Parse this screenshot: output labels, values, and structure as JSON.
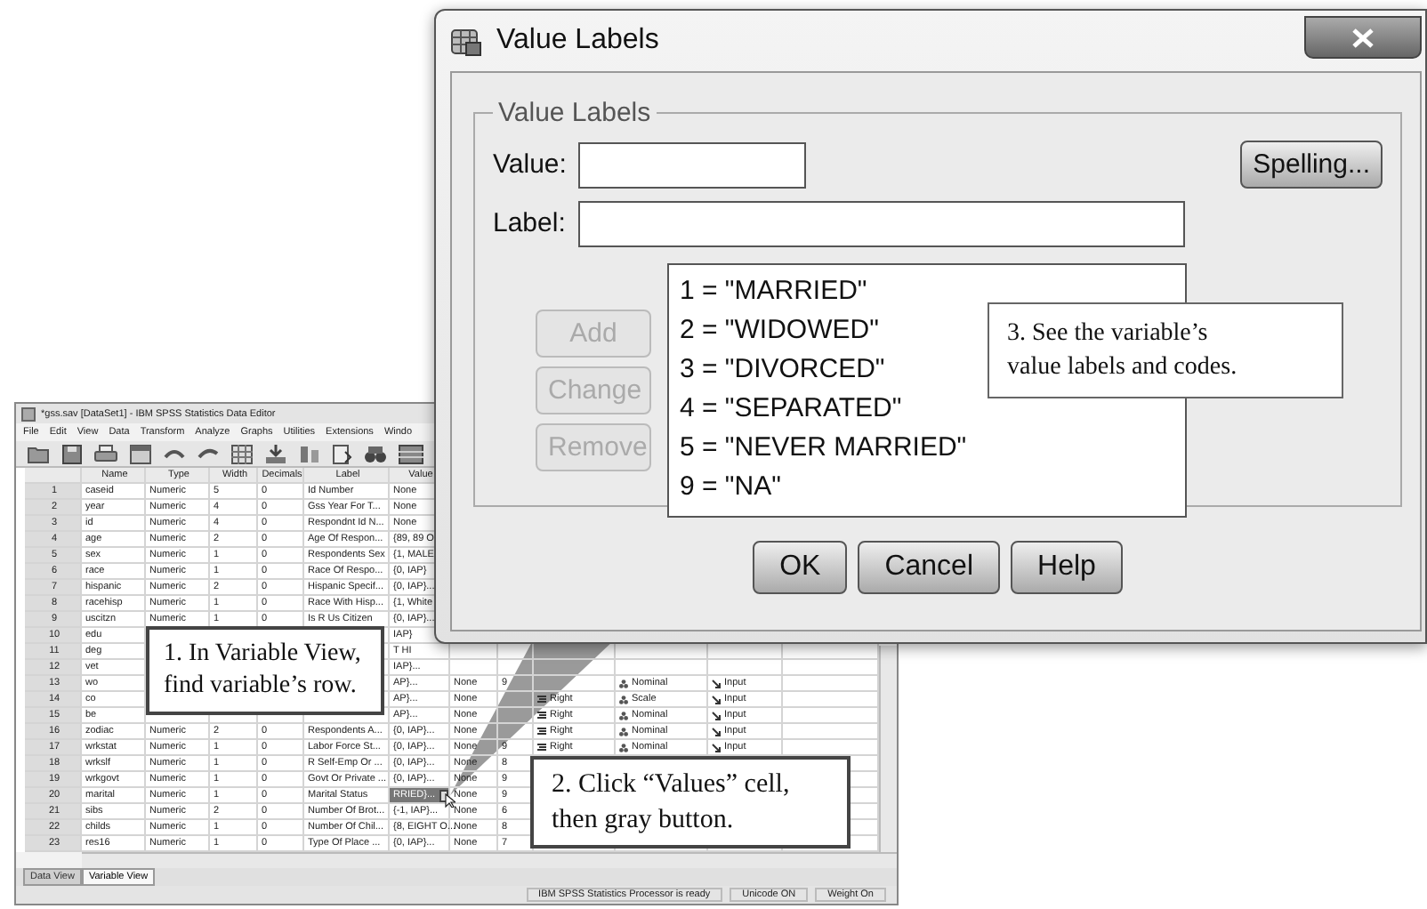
{
  "data_editor": {
    "title": "*gss.sav [DataSet1] - IBM SPSS Statistics Data Editor",
    "menu": [
      "File",
      "Edit",
      "View",
      "Data",
      "Transform",
      "Analyze",
      "Graphs",
      "Utilities",
      "Extensions",
      "Windo"
    ],
    "headers": [
      "Name",
      "Type",
      "Width",
      "Decimals",
      "Label",
      "Value"
    ],
    "rows": [
      {
        "number": "1",
        "editing": false,
        "cells": [
          "caseid",
          "Numeric",
          "5",
          "0",
          "Id Number",
          "None",
          null,
          null,
          null,
          null,
          null
        ]
      },
      {
        "number": "2",
        "editing": false,
        "cells": [
          "year",
          "Numeric",
          "4",
          "0",
          "Gss Year For T...",
          "None",
          null,
          null,
          null,
          null,
          null
        ]
      },
      {
        "number": "3",
        "editing": false,
        "cells": [
          "id",
          "Numeric",
          "4",
          "0",
          "Respondnt Id N...",
          "None",
          null,
          null,
          null,
          null,
          null
        ]
      },
      {
        "number": "4",
        "editing": false,
        "cells": [
          "age",
          "Numeric",
          "2",
          "0",
          "Age Of Respon...",
          "{89, 89 O",
          null,
          null,
          null,
          null,
          null
        ]
      },
      {
        "number": "5",
        "editing": false,
        "cells": [
          "sex",
          "Numeric",
          "1",
          "0",
          "Respondents Sex",
          "{1, MALE",
          null,
          null,
          null,
          null,
          null
        ]
      },
      {
        "number": "6",
        "editing": false,
        "cells": [
          "race",
          "Numeric",
          "1",
          "0",
          "Race Of Respo...",
          "{0, IAP}",
          null,
          null,
          null,
          null,
          null
        ]
      },
      {
        "number": "7",
        "editing": false,
        "cells": [
          "hispanic",
          "Numeric",
          "2",
          "0",
          "Hispanic Specif...",
          "{0, IAP}...",
          null,
          null,
          null,
          null,
          null
        ]
      },
      {
        "number": "8",
        "editing": false,
        "cells": [
          "racehisp",
          "Numeric",
          "1",
          "0",
          "Race With Hisp...",
          "{1, White",
          null,
          null,
          null,
          null,
          null
        ]
      },
      {
        "number": "9",
        "editing": false,
        "cells": [
          "uscitzn",
          "Numeric",
          "1",
          "0",
          "Is R Us Citizen",
          "{0, IAP}...",
          null,
          null,
          null,
          null,
          null
        ]
      },
      {
        "number": "10",
        "editing": false,
        "cells": [
          "edu",
          null,
          null,
          null,
          null,
          "IAP}",
          null,
          null,
          null,
          null,
          null
        ]
      },
      {
        "number": "11",
        "editing": false,
        "cells": [
          "deg",
          null,
          null,
          null,
          null,
          "T HI",
          null,
          null,
          null,
          null,
          null
        ]
      },
      {
        "number": "12",
        "editing": false,
        "cells": [
          "vet",
          null,
          null,
          null,
          null,
          "IAP}...",
          null,
          null,
          null,
          null,
          null
        ]
      },
      {
        "number": "13",
        "editing": false,
        "cells": [
          "wo",
          null,
          null,
          null,
          null,
          "AP}...",
          "None",
          "9",
          null,
          "Nominal",
          "Input"
        ]
      },
      {
        "number": "14",
        "editing": false,
        "cells": [
          "co",
          null,
          null,
          null,
          null,
          "AP}...",
          "None",
          null,
          "Right",
          "Scale",
          "Input"
        ]
      },
      {
        "number": "15",
        "editing": false,
        "cells": [
          "be",
          null,
          null,
          null,
          null,
          "AP}...",
          "None",
          null,
          "Right",
          "Nominal",
          "Input"
        ]
      },
      {
        "number": "16",
        "editing": false,
        "cells": [
          "zodiac",
          "Numeric",
          "2",
          "0",
          "Respondents A...",
          "{0, IAP}...",
          "None",
          null,
          "Right",
          "Nominal",
          "Input"
        ]
      },
      {
        "number": "17",
        "editing": false,
        "cells": [
          "wrkstat",
          "Numeric",
          "1",
          "0",
          "Labor Force St...",
          "{0, IAP}...",
          "None",
          "9",
          "Right",
          "Nominal",
          "Input"
        ]
      },
      {
        "number": "18",
        "editing": false,
        "cells": [
          "wrkslf",
          "Numeric",
          "1",
          "0",
          "R Self-Emp Or ...",
          "{0, IAP}...",
          "None",
          "8",
          null,
          null,
          null
        ]
      },
      {
        "number": "19",
        "editing": false,
        "cells": [
          "wrkgovt",
          "Numeric",
          "1",
          "0",
          "Govt Or Private ...",
          "{0, IAP}...",
          "None",
          "9",
          null,
          null,
          null
        ]
      },
      {
        "number": "20",
        "editing": true,
        "cells": [
          "marital",
          "Numeric",
          "1",
          "0",
          "Marital Status",
          "RRIED}...",
          "None",
          "9",
          null,
          null,
          null
        ]
      },
      {
        "number": "21",
        "editing": false,
        "cells": [
          "sibs",
          "Numeric",
          "2",
          "0",
          "Number Of Brot...",
          "{-1, IAP}...",
          "None",
          "6",
          null,
          null,
          null
        ]
      },
      {
        "number": "22",
        "editing": false,
        "cells": [
          "childs",
          "Numeric",
          "1",
          "0",
          "Number Of Chil...",
          "{8, EIGHT O...",
          "None",
          "8",
          null,
          null,
          null
        ]
      },
      {
        "number": "23",
        "editing": false,
        "cells": [
          "res16",
          "Numeric",
          "1",
          "0",
          "Type Of Place ...",
          "{0, IAP}...",
          "None",
          "7",
          null,
          null,
          null
        ]
      }
    ],
    "tabs": [
      {
        "label": "Data View",
        "selected": false
      },
      {
        "label": "Variable View",
        "selected": true
      }
    ],
    "status_bar": [
      "IBM SPSS Statistics Processor is ready",
      "Unicode ON",
      "Weight On"
    ]
  },
  "dialog": {
    "title": "Value Labels",
    "group_title": "Value Labels",
    "value_label": "Value:",
    "label_label": "Label:",
    "spelling_button": "Spelling...",
    "side_buttons": [
      {
        "label": "Add",
        "disabled": true
      },
      {
        "label": "Change",
        "disabled": true
      },
      {
        "label": "Remove",
        "disabled": true
      }
    ],
    "labels_list": [
      "1 = \"MARRIED\"",
      "2 = \"WIDOWED\"",
      "3 = \"DIVORCED\"",
      "4 = \"SEPARATED\"",
      "5 = \"NEVER MARRIED\"",
      "9 = \"NA\""
    ],
    "buttons": [
      {
        "label": "OK",
        "disabled": false
      },
      {
        "label": "Cancel",
        "disabled": false
      },
      {
        "label": "Help",
        "disabled": false
      }
    ]
  },
  "callouts": [
    {
      "lines": [
        "1. In Variable View,",
        "find variable’s row."
      ]
    },
    {
      "lines": [
        "2. Click “Values” cell,",
        "then gray button."
      ]
    },
    {
      "lines": [
        "3. See the variable’s",
        "value labels and codes."
      ]
    }
  ]
}
